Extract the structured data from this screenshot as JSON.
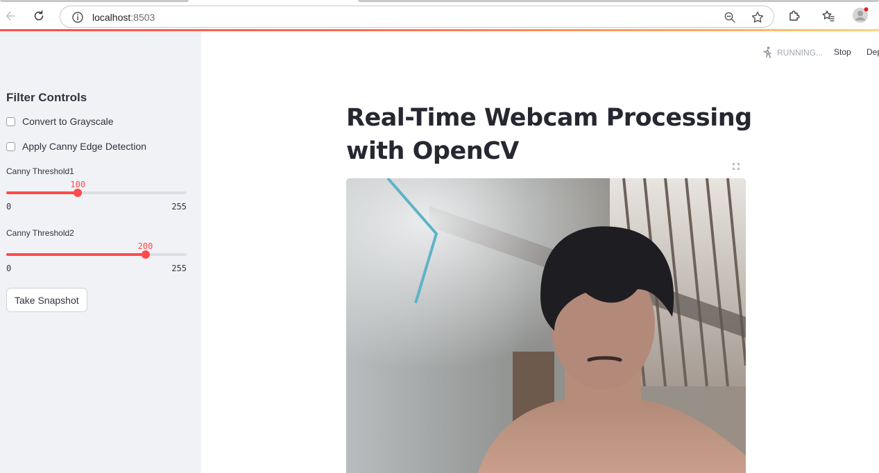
{
  "browser": {
    "url_host": "localhost",
    "url_port": ":8503",
    "icons": {
      "back": "back-arrow-icon",
      "reload": "reload-icon",
      "info": "site-info-icon",
      "zoom": "zoom-out-icon",
      "bookmark": "star-icon",
      "extensions": "puzzle-icon",
      "favorites": "favorites-icon",
      "profile": "profile-avatar-icon"
    }
  },
  "sidebar": {
    "title": "Filter Controls",
    "grayscale_label": "Convert to Grayscale",
    "grayscale_checked": false,
    "canny_label": "Apply Canny Edge Detection",
    "canny_checked": false,
    "threshold1": {
      "label": "Canny Threshold1",
      "value": "100",
      "min": "0",
      "max": "255"
    },
    "threshold2": {
      "label": "Canny Threshold2",
      "value": "200",
      "min": "0",
      "max": "255"
    },
    "snapshot_label": "Take Snapshot"
  },
  "header": {
    "status": "RUNNING...",
    "stop": "Stop",
    "deploy": "Deploy"
  },
  "main": {
    "title": "Real-Time Webcam Processing with OpenCV",
    "video_alt": "webcam frame"
  },
  "colors": {
    "accent": "#ff4b4b",
    "sidebar_bg": "#f0f2f6",
    "text": "#31333f"
  }
}
